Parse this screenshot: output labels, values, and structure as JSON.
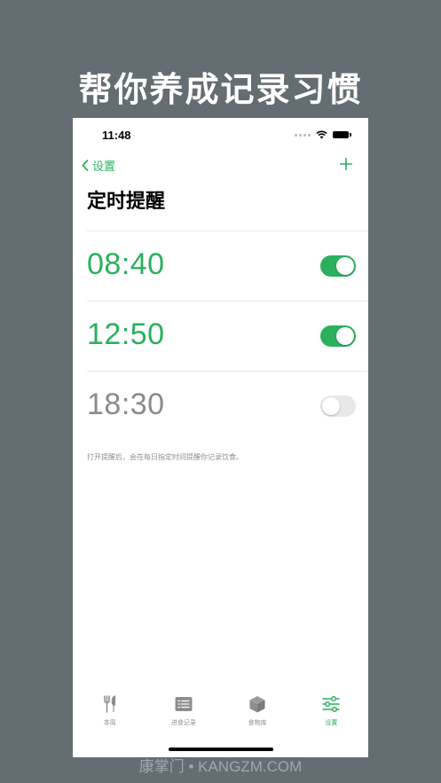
{
  "banner": {
    "headline": "帮你养成记录习惯"
  },
  "status_bar": {
    "time": "11:48"
  },
  "nav": {
    "back_label": "设置",
    "title": "定时提醒"
  },
  "reminders": [
    {
      "time": "08:40",
      "enabled": true
    },
    {
      "time": "12:50",
      "enabled": true
    },
    {
      "time": "18:30",
      "enabled": false
    }
  ],
  "hint_text": "打开提醒后，会在每日指定时间提醒你记录饮食。",
  "tabbar": {
    "tabs": [
      {
        "label": "本周",
        "icon": "fork-knife-icon",
        "active": false
      },
      {
        "label": "进食记录",
        "icon": "list-icon",
        "active": false
      },
      {
        "label": "食物库",
        "icon": "box-icon",
        "active": false
      },
      {
        "label": "设置",
        "icon": "sliders-icon",
        "active": true
      }
    ]
  },
  "watermark": "康掌门 • KANGZM.COM",
  "colors": {
    "accent": "#2bb05e",
    "background": "#636d72",
    "inactive": "#8e8e8e"
  }
}
